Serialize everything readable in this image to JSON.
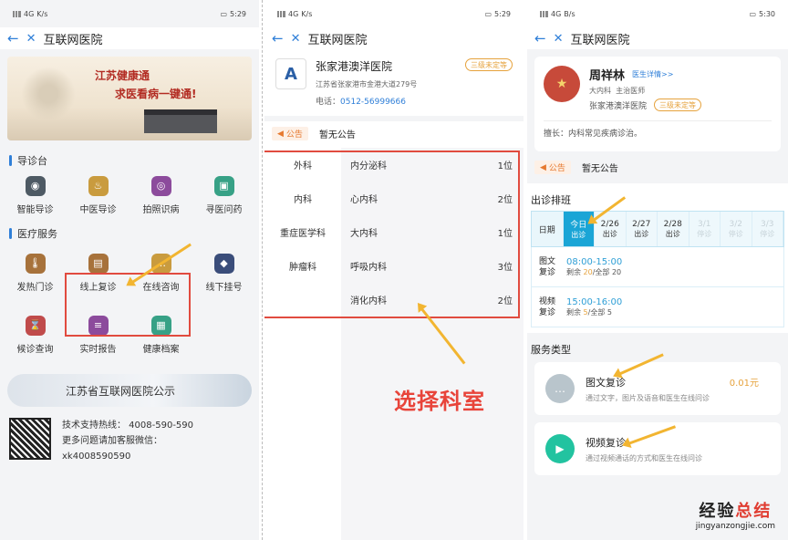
{
  "p1": {
    "status": {
      "net": "4G",
      "speed": "K/s",
      "time": "5:29"
    },
    "title": "互联网医院",
    "banner": {
      "line1": "江苏健康通",
      "line2": "求医看病一键通!"
    },
    "sec1": "导诊台",
    "guide": [
      {
        "label": "智能导诊",
        "icon": "robot-icon"
      },
      {
        "label": "中医导诊",
        "icon": "herb-icon"
      },
      {
        "label": "拍照识病",
        "icon": "camera-icon"
      },
      {
        "label": "寻医问药",
        "icon": "medicine-bottle-icon"
      }
    ],
    "sec2": "医疗服务",
    "services": [
      {
        "label": "发热门诊",
        "icon": "thermometer-icon"
      },
      {
        "label": "线上复诊",
        "icon": "clipboard-icon"
      },
      {
        "label": "在线咨询",
        "icon": "chat-icon"
      },
      {
        "label": "线下挂号",
        "icon": "diamond-icon"
      },
      {
        "label": "候诊查询",
        "icon": "waiting-icon"
      },
      {
        "label": "实时报告",
        "icon": "report-icon"
      },
      {
        "label": "健康档案",
        "icon": "record-icon"
      }
    ],
    "notice": "江苏省互联网医院公示",
    "support": {
      "hotline": "技术支持热线：  4008-590-590",
      "wechat": "更多问题请加客服微信：",
      "id": "xk4008590590"
    }
  },
  "p2": {
    "status": {
      "net": "4G",
      "speed": "K/s",
      "time": "5:29"
    },
    "title": "互联网医院",
    "hospital": {
      "name": "张家港澳洋医院",
      "badge": "三级未定等",
      "address": "江苏省张家港市金港大道279号",
      "tel_label": "电话：",
      "tel": "0512-56999666"
    },
    "announce": {
      "tag": "公告",
      "text": "暂无公告"
    },
    "departments": [
      "外科",
      "内科",
      "重症医学科",
      "肿瘤科"
    ],
    "subdepts": [
      {
        "name": "内分泌科",
        "count": "1位"
      },
      {
        "name": "心内科",
        "count": "2位"
      },
      {
        "name": "大内科",
        "count": "1位"
      },
      {
        "name": "呼吸内科",
        "count": "3位"
      },
      {
        "name": "消化内科",
        "count": "2位"
      }
    ],
    "callout": "选择科室"
  },
  "p3": {
    "status": {
      "net": "4G",
      "speed": "B/s",
      "time": "5:30"
    },
    "title": "互联网医院",
    "doctor": {
      "name": "周祥林",
      "detail": "医生详情>>",
      "dept": "大内科",
      "title": "主治医师",
      "hospital": "张家港澳洋医院",
      "badge": "三级未定等",
      "skill": "擅长：内科常见疾病诊治。"
    },
    "announce": {
      "tag": "公告",
      "text": "暂无公告"
    },
    "sched_title": "出诊排班",
    "days": [
      {
        "d": "日期",
        "s": ""
      },
      {
        "d": "今日",
        "s": "出诊"
      },
      {
        "d": "2/26",
        "s": "出诊"
      },
      {
        "d": "2/27",
        "s": "出诊"
      },
      {
        "d": "2/28",
        "s": "出诊"
      },
      {
        "d": "3/1",
        "s": "停诊"
      },
      {
        "d": "3/2",
        "s": "停诊"
      },
      {
        "d": "3/3",
        "s": "停诊"
      }
    ],
    "slots": [
      {
        "k1": "图文",
        "k2": "复诊",
        "time": "08:00-15:00",
        "rem_pre": "剩余 ",
        "rem": "20",
        "rem_post": "/全部 20"
      },
      {
        "k1": "视频",
        "k2": "复诊",
        "time": "15:00-16:00",
        "rem_pre": "剩余 ",
        "rem": "5",
        "rem_post": "/全部 5"
      }
    ],
    "svc_title": "服务类型",
    "svc": [
      {
        "name": "图文复诊",
        "desc": "通过文字，图片及语音和医生在线问诊",
        "price": "0.01元",
        "icon": "chat-bubble-icon",
        "color": "#b9c5cc"
      },
      {
        "name": "视频复诊",
        "desc": "通过视频通话的方式和医生在线问诊",
        "price": "",
        "icon": "video-icon",
        "color": "#22c3a0"
      }
    ]
  },
  "watermark": {
    "a1": "经验",
    "a2": "总结",
    "b": "jingyanzongjie.com"
  }
}
